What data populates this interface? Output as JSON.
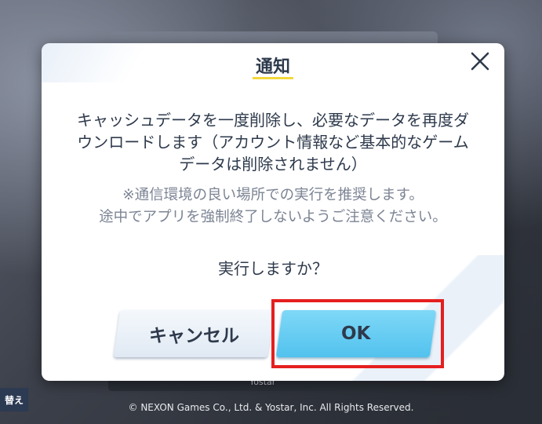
{
  "dialog": {
    "title": "通知",
    "body_lines": [
      "キャッシュデータを一度削除し、必要なデータを再度ダ",
      "ウンロードします（アカウント情報など基本的なゲーム",
      "データは削除されません）"
    ],
    "note_lines": [
      "※通信環境の良い場所での実行を推奨します。",
      "途中でアプリを強制終了しないようご注意ください。"
    ],
    "confirm": "実行しますか？",
    "cancel_label": "キャンセル",
    "ok_label": "OK"
  },
  "background": {
    "bottom_text": "Yostar",
    "side_button_label": "替え",
    "copyright": "© NEXON Games Co., Ltd. & Yostar, Inc. All Rights Reserved."
  },
  "colors": {
    "accent_underline": "#f3d83c",
    "ok_button": "#5ccaf2",
    "highlight_box": "#e51f1f",
    "text": "#2e3a4c"
  },
  "icons": {
    "close": "close-icon"
  }
}
